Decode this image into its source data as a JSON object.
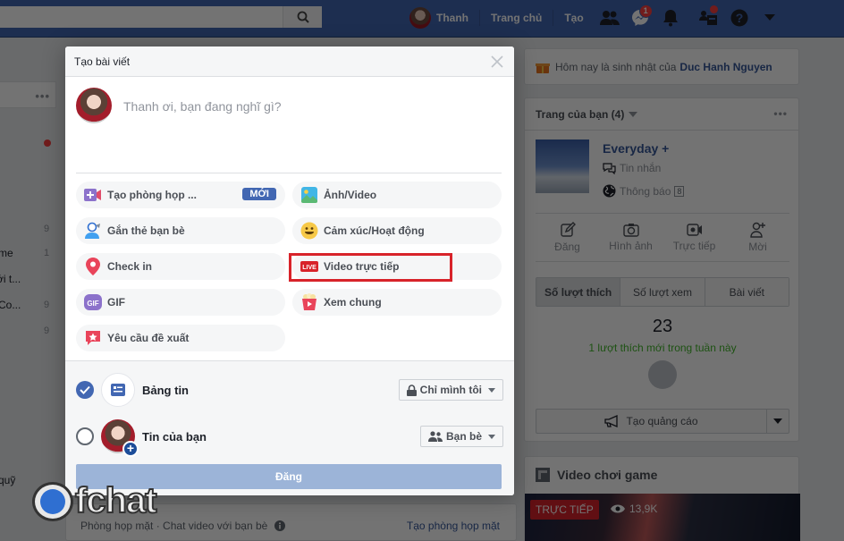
{
  "topbar": {
    "user_name": "Thanh",
    "home_label": "Trang chủ",
    "create_label": "Tạo",
    "messenger_badge": "1",
    "icons": [
      "search-icon",
      "friends-icon",
      "messenger-icon",
      "notifications-icon",
      "friend-requests-icon",
      "help-icon",
      "account-menu-caret-icon"
    ]
  },
  "left_column": {
    "partial_items": [
      {
        "text": "me",
        "count": "1"
      },
      {
        "text": "ới t...",
        "count": ""
      },
      {
        "text": "Co...",
        "count": "9"
      },
      {
        "text": "",
        "count": "9"
      }
    ],
    "top_count": "9",
    "bottom_text": "quỹ"
  },
  "modal": {
    "title": "Tạo bài viết",
    "composer_placeholder": "Thanh ơi, bạn đang nghĩ gì?",
    "options": [
      {
        "label": "Tạo phòng họp ...",
        "icon": "video-room-icon",
        "badge": "MỚI"
      },
      {
        "label": "Ảnh/Video",
        "icon": "photo-icon"
      },
      {
        "label": "Gắn thẻ bạn bè",
        "icon": "tag-friends-icon"
      },
      {
        "label": "Cảm xúc/Hoạt động",
        "icon": "feeling-emoji-icon"
      },
      {
        "label": "Check in",
        "icon": "location-pin-icon"
      },
      {
        "label": "Video trực tiếp",
        "icon": "live-video-icon",
        "live_tag": "LIVE"
      },
      {
        "label": "GIF",
        "icon": "gif-icon"
      },
      {
        "label": "Xem chung",
        "icon": "watch-party-icon"
      },
      {
        "label": "Yêu cầu đề xuất",
        "icon": "recommendation-icon"
      }
    ],
    "share": [
      {
        "label": "Bảng tin",
        "checked": true,
        "privacy": "Chỉ mình tôi",
        "privacy_icon": "lock-icon"
      },
      {
        "label": "Tin của bạn",
        "checked": false,
        "privacy": "Bạn bè",
        "privacy_icon": "friends-icon"
      }
    ],
    "post_button": "Đăng"
  },
  "right_column": {
    "birthday_text": "Hôm nay là sinh nhật của",
    "birthday_name": "Duc Hanh Nguyen",
    "pages_header": "Trang của bạn (4)",
    "page_name": "Everyday +",
    "messages_label": "Tin nhắn",
    "notifications_label": "Thông báo",
    "notifications_count": "8",
    "actions": [
      "Đăng",
      "Hình ảnh",
      "Trực tiếp",
      "Mời"
    ],
    "tabs": [
      "Số lượt thích",
      "Số lượt xem",
      "Bài viết"
    ],
    "likes_count": "23",
    "likes_sub": "1 lượt thích mới trong tuần này",
    "ads_button": "Tạo quảng cáo",
    "games_header": "Video chơi game",
    "live_label": "TRỰC TIẾP",
    "views": "13,9K"
  },
  "feed": {
    "room_text": "Phòng họp mặt · Chat video với bạn bè",
    "room_link": "Tạo phòng họp mặt"
  },
  "watermark": {
    "text": "fchat"
  },
  "colors": {
    "brand": "#4267b2",
    "highlight": "#d8232a",
    "post_disabled": "#9cb4d8",
    "green": "#42b72a"
  }
}
